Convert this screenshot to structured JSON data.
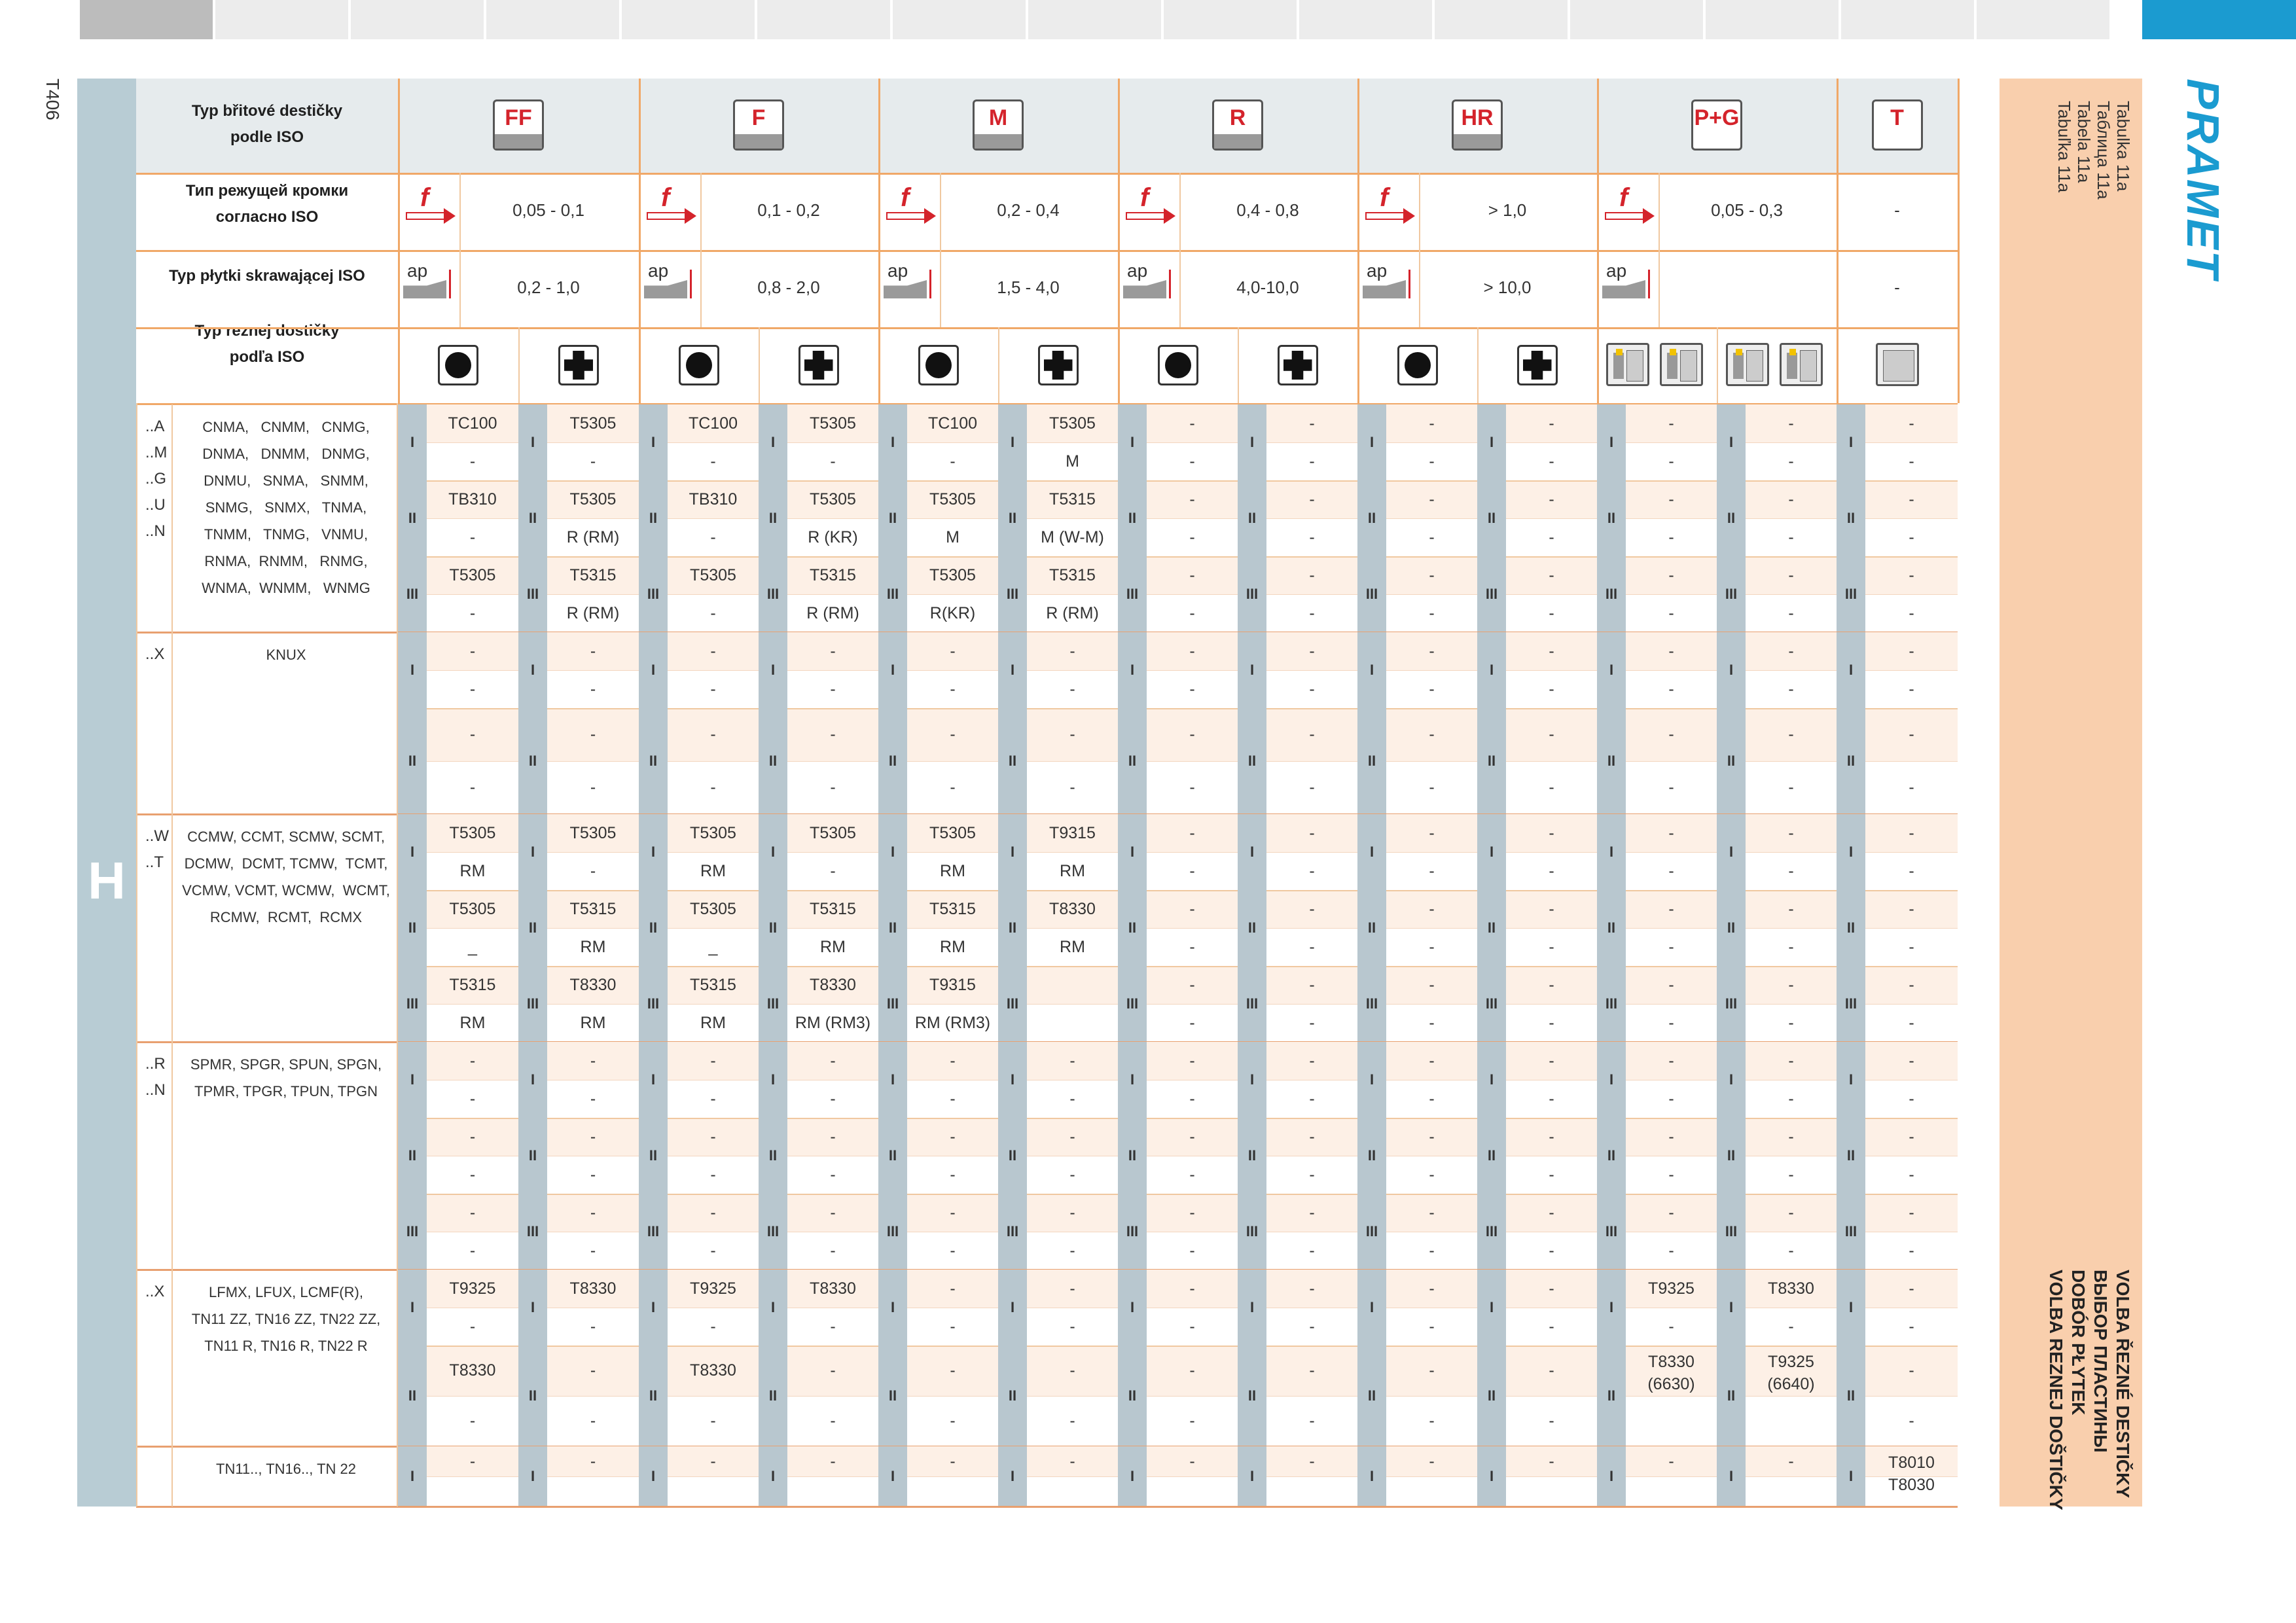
{
  "page_code": "T406",
  "section_letter": "H",
  "brand": "PRAMET",
  "table_refs": [
    "Tabulka 11a",
    "Таблица 11a",
    "Tabela 11a",
    "Tabuľka 11a"
  ],
  "banner_titles": [
    "VOLBA ŘEZNÉ DESTIČKY",
    "ВЫБОР ПЛАСТИНЫ",
    "DOBÓR PŁYTEK",
    "VOLBA REZNEJ DOŠTIČKY"
  ],
  "header_labels": {
    "row1": [
      "Typ břitové destičky",
      "podle ISO"
    ],
    "row2": [
      "Тип режущей кромки",
      "согласно ISO"
    ],
    "row3": [
      "Typ płytki skrawającej ISO"
    ],
    "row4": [
      "Typ reznej dostičky",
      "podľa ISO"
    ]
  },
  "modes": [
    {
      "code": "FF",
      "f_range": "0,05 - 0,1",
      "ap_range": "0,2 - 1,0"
    },
    {
      "code": "F",
      "f_range": "0,1 - 0,2",
      "ap_range": "0,8 - 2,0"
    },
    {
      "code": "M",
      "f_range": "0,2 - 0,4",
      "ap_range": "1,5 - 4,0"
    },
    {
      "code": "R",
      "f_range": "0,4 - 0,8",
      "ap_range": "4,0-10,0"
    },
    {
      "code": "HR",
      "f_range": "> 1,0",
      "ap_range": "> 10,0"
    },
    {
      "code": "P+G",
      "f_range": "0,05 - 0,3",
      "ap_range": ""
    },
    {
      "code": "T",
      "f_range": "-",
      "ap_range": "-"
    }
  ],
  "icons": {
    "f_symbol": "f",
    "ap_symbol": "ap",
    "shapes": [
      "round-insert-icon",
      "cross-insert-icon"
    ],
    "pg_tools": [
      "parting-tool-icon",
      "grooving-tool-icon"
    ],
    "threading": "threading-tool-icon"
  },
  "roman": [
    "I",
    "II",
    "III"
  ],
  "groups": [
    {
      "codes": "..A\n..M\n..G\n..U\n..N",
      "types": "CNMA,   CNMM,   CNMG,\nDNMA,   DNMM,   DNMG,\nDNMU,   SNMA,   SNMM,\nSNMG,   SNMX,   TNMA,\nTNMM,   TNMG,   VNMU,\nRNMA,  RNMM,   RNMG,\nWNMA,  WNMM,   WNMG",
      "rows": [
        {
          "roman": "I",
          "cells": [
            [
              "TC100",
              "-"
            ],
            [
              "T5305",
              "-"
            ],
            [
              "TC100",
              "-"
            ],
            [
              "T5305",
              "-"
            ],
            [
              "TC100",
              "-"
            ],
            [
              "T5305",
              "M"
            ],
            [
              "-",
              "-"
            ],
            [
              "-",
              "-"
            ],
            [
              "-",
              "-"
            ],
            [
              "-",
              "-"
            ],
            [
              "-",
              "-"
            ],
            [
              "-",
              "-"
            ],
            [
              "-",
              "-"
            ]
          ]
        },
        {
          "roman": "II",
          "cells": [
            [
              "TB310",
              "-"
            ],
            [
              "T5305",
              "R (RM)"
            ],
            [
              "TB310",
              "-"
            ],
            [
              "T5305",
              "R (KR)"
            ],
            [
              "T5305",
              "M"
            ],
            [
              "T5315",
              "M (W-M)"
            ],
            [
              "-",
              "-"
            ],
            [
              "-",
              "-"
            ],
            [
              "-",
              "-"
            ],
            [
              "-",
              "-"
            ],
            [
              "-",
              "-"
            ],
            [
              "-",
              "-"
            ],
            [
              "-",
              "-"
            ]
          ]
        },
        {
          "roman": "III",
          "cells": [
            [
              "T5305",
              "-"
            ],
            [
              "T5315",
              "R (RM)"
            ],
            [
              "T5305",
              "-"
            ],
            [
              "T5315",
              "R (RM)"
            ],
            [
              "T5305",
              "R(KR)"
            ],
            [
              "T5315",
              "R (RM)"
            ],
            [
              "-",
              "-"
            ],
            [
              "-",
              "-"
            ],
            [
              "-",
              "-"
            ],
            [
              "-",
              "-"
            ],
            [
              "-",
              "-"
            ],
            [
              "-",
              "-"
            ],
            [
              "-",
              "-"
            ]
          ]
        }
      ]
    },
    {
      "codes": "..X",
      "types": "KNUX",
      "rows": [
        {
          "roman": "I",
          "cells": [
            [
              "-",
              "-"
            ],
            [
              "-",
              "-"
            ],
            [
              "-",
              "-"
            ],
            [
              "-",
              "-"
            ],
            [
              "-",
              "-"
            ],
            [
              "-",
              "-"
            ],
            [
              "-",
              "-"
            ],
            [
              "-",
              "-"
            ],
            [
              "-",
              "-"
            ],
            [
              "-",
              "-"
            ],
            [
              "-",
              "-"
            ],
            [
              "-",
              "-"
            ],
            [
              "-",
              "-"
            ]
          ]
        },
        {
          "roman": "II",
          "cells": [
            [
              "-",
              "-"
            ],
            [
              "-",
              "-"
            ],
            [
              "-",
              "-"
            ],
            [
              "-",
              "-"
            ],
            [
              "-",
              "-"
            ],
            [
              "-",
              "-"
            ],
            [
              "-",
              "-"
            ],
            [
              "-",
              "-"
            ],
            [
              "-",
              "-"
            ],
            [
              "-",
              "-"
            ],
            [
              "-",
              "-"
            ],
            [
              "-",
              "-"
            ],
            [
              "-",
              "-"
            ]
          ]
        }
      ]
    },
    {
      "codes": "..W\n..T",
      "types": "CCMW, CCMT, SCMW, SCMT,\nDCMW,  DCMT, TCMW,  TCMT,\nVCMW, VCMT, WCMW,  WCMT,\nRCMW,  RCMT,  RCMX",
      "rows": [
        {
          "roman": "I",
          "cells": [
            [
              "T5305",
              "RM"
            ],
            [
              "T5305",
              "-"
            ],
            [
              "T5305",
              "RM"
            ],
            [
              "T5305",
              "-"
            ],
            [
              "T5305",
              "RM"
            ],
            [
              "T9315",
              "RM"
            ],
            [
              "-",
              "-"
            ],
            [
              "-",
              "-"
            ],
            [
              "-",
              "-"
            ],
            [
              "-",
              "-"
            ],
            [
              "-",
              "-"
            ],
            [
              "-",
              "-"
            ],
            [
              "-",
              "-"
            ]
          ]
        },
        {
          "roman": "II",
          "cells": [
            [
              "T5305",
              "_"
            ],
            [
              "T5315",
              "RM"
            ],
            [
              "T5305",
              "_"
            ],
            [
              "T5315",
              "RM"
            ],
            [
              "T5315",
              "RM"
            ],
            [
              "T8330",
              "RM"
            ],
            [
              "-",
              "-"
            ],
            [
              "-",
              "-"
            ],
            [
              "-",
              "-"
            ],
            [
              "-",
              "-"
            ],
            [
              "-",
              "-"
            ],
            [
              "-",
              "-"
            ],
            [
              "-",
              "-"
            ]
          ]
        },
        {
          "roman": "III",
          "cells": [
            [
              "T5315",
              "RM"
            ],
            [
              "T8330",
              "RM"
            ],
            [
              "T5315",
              "RM"
            ],
            [
              "T8330",
              "RM (RM3)"
            ],
            [
              "T9315",
              "RM (RM3)"
            ],
            [
              "",
              ""
            ],
            [
              "-",
              "-"
            ],
            [
              "-",
              "-"
            ],
            [
              "-",
              "-"
            ],
            [
              "-",
              "-"
            ],
            [
              "-",
              "-"
            ],
            [
              "-",
              "-"
            ],
            [
              "-",
              "-"
            ]
          ]
        }
      ]
    },
    {
      "codes": "..R\n..N",
      "types": "SPMR, SPGR, SPUN, SPGN,\nTPMR, TPGR, TPUN, TPGN",
      "rows": [
        {
          "roman": "I",
          "cells": [
            [
              "-",
              "-"
            ],
            [
              "-",
              "-"
            ],
            [
              "-",
              "-"
            ],
            [
              "-",
              "-"
            ],
            [
              "-",
              "-"
            ],
            [
              "-",
              "-"
            ],
            [
              "-",
              "-"
            ],
            [
              "-",
              "-"
            ],
            [
              "-",
              "-"
            ],
            [
              "-",
              "-"
            ],
            [
              "-",
              "-"
            ],
            [
              "-",
              "-"
            ],
            [
              "-",
              "-"
            ]
          ]
        },
        {
          "roman": "II",
          "cells": [
            [
              "-",
              "-"
            ],
            [
              "-",
              "-"
            ],
            [
              "-",
              "-"
            ],
            [
              "-",
              "-"
            ],
            [
              "-",
              "-"
            ],
            [
              "-",
              "-"
            ],
            [
              "-",
              "-"
            ],
            [
              "-",
              "-"
            ],
            [
              "-",
              "-"
            ],
            [
              "-",
              "-"
            ],
            [
              "-",
              "-"
            ],
            [
              "-",
              "-"
            ],
            [
              "-",
              "-"
            ]
          ]
        },
        {
          "roman": "III",
          "cells": [
            [
              "-",
              "-"
            ],
            [
              "-",
              "-"
            ],
            [
              "-",
              "-"
            ],
            [
              "-",
              "-"
            ],
            [
              "-",
              "-"
            ],
            [
              "-",
              "-"
            ],
            [
              "-",
              "-"
            ],
            [
              "-",
              "-"
            ],
            [
              "-",
              "-"
            ],
            [
              "-",
              "-"
            ],
            [
              "-",
              "-"
            ],
            [
              "-",
              "-"
            ],
            [
              "-",
              "-"
            ]
          ]
        }
      ]
    },
    {
      "codes": "..X",
      "types": "LFMX, LFUX, LCMF(R),\nTN11 ZZ, TN16 ZZ, TN22 ZZ,\nTN11 R, TN16 R, TN22 R",
      "rows": [
        {
          "roman": "I",
          "cells": [
            [
              "T9325",
              "-"
            ],
            [
              "T8330",
              "-"
            ],
            [
              "T9325",
              "-"
            ],
            [
              "T8330",
              "-"
            ],
            [
              "-",
              "-"
            ],
            [
              "-",
              "-"
            ],
            [
              "-",
              "-"
            ],
            [
              "-",
              "-"
            ],
            [
              "-",
              "-"
            ],
            [
              "-",
              "-"
            ],
            [
              "T9325",
              "-"
            ],
            [
              "T8330",
              "-"
            ],
            [
              "-",
              "-"
            ]
          ]
        },
        {
          "roman": "II",
          "cells": [
            [
              "T8330",
              "-"
            ],
            [
              "-",
              "-"
            ],
            [
              "T8330",
              "-"
            ],
            [
              "-",
              "-"
            ],
            [
              "-",
              "-"
            ],
            [
              "-",
              "-"
            ],
            [
              "-",
              "-"
            ],
            [
              "-",
              "-"
            ],
            [
              "-",
              "-"
            ],
            [
              "-",
              "-"
            ],
            [
              "T8330\n(6630)",
              "-"
            ],
            [
              "T9325\n(6640)",
              "-"
            ],
            [
              "-",
              "-"
            ]
          ]
        }
      ]
    },
    {
      "codes": "",
      "types": "TN11.., TN16.., TN 22",
      "rows": [
        {
          "roman": "I",
          "cells": [
            [
              "-",
              ""
            ],
            [
              "-",
              ""
            ],
            [
              "-",
              ""
            ],
            [
              "-",
              ""
            ],
            [
              "-",
              ""
            ],
            [
              "-",
              ""
            ],
            [
              "-",
              ""
            ],
            [
              "-",
              ""
            ],
            [
              "-",
              ""
            ],
            [
              "-",
              ""
            ],
            [
              "-",
              ""
            ],
            [
              "-",
              ""
            ],
            [
              "T8010\nT8030",
              ""
            ]
          ]
        }
      ]
    }
  ]
}
